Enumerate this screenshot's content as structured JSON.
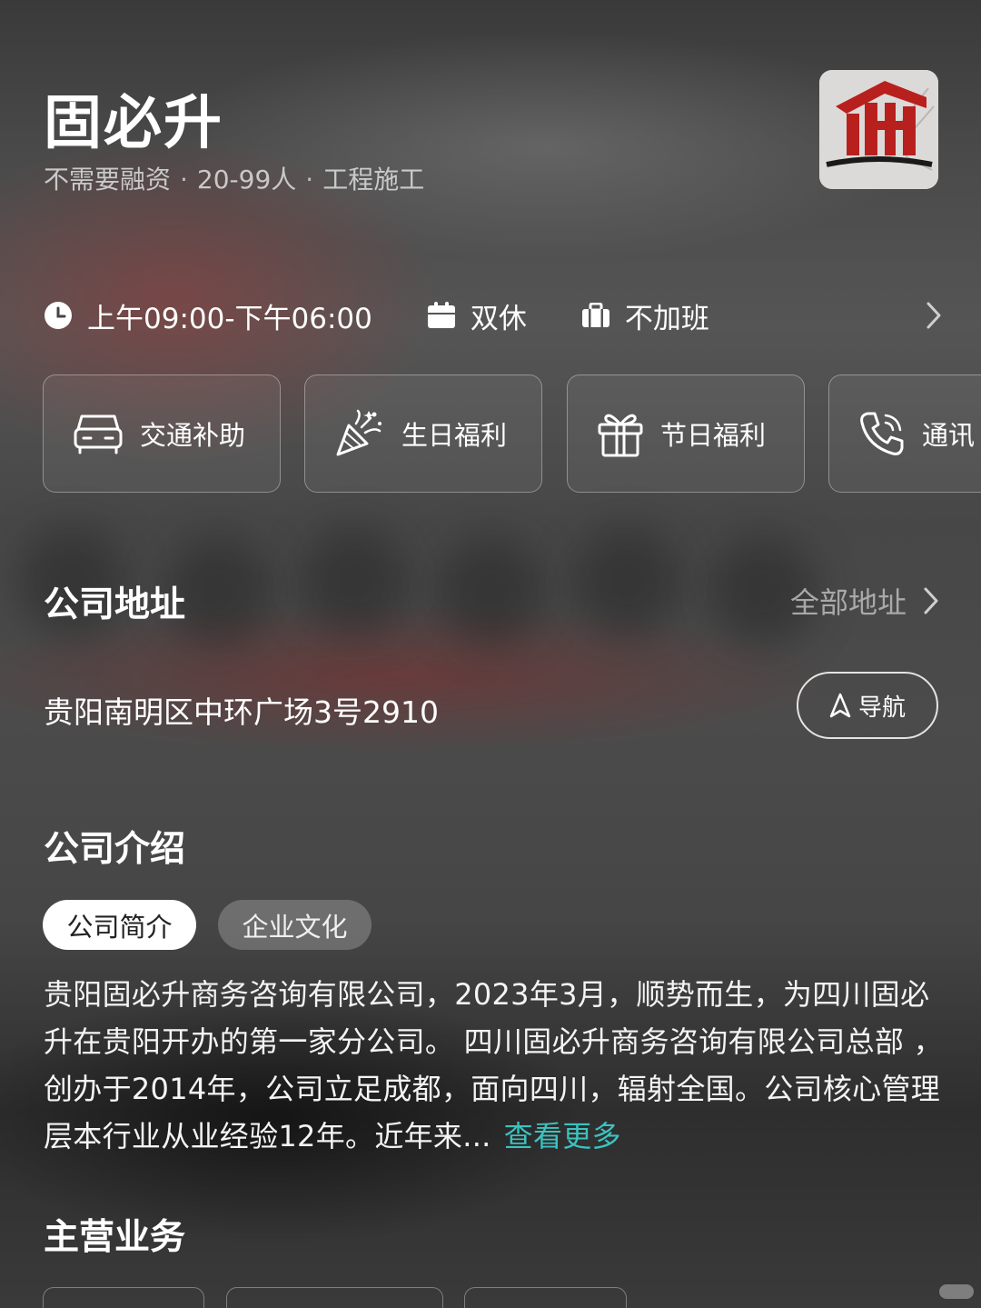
{
  "company": {
    "name": "固必升",
    "tags": [
      "不需要融资",
      "20-99人",
      "工程施工"
    ],
    "separator": "·"
  },
  "worktime": {
    "hours": "上午09:00-下午06:00",
    "rest": "双休",
    "overtime": "不加班"
  },
  "benefits": [
    {
      "label": "交通补助",
      "icon": "car-icon"
    },
    {
      "label": "生日福利",
      "icon": "party-popper-icon"
    },
    {
      "label": "节日福利",
      "icon": "gift-icon"
    },
    {
      "label": "通讯",
      "icon": "phone-icon"
    }
  ],
  "address_section": {
    "title": "公司地址",
    "all_link": "全部地址",
    "address": "贵阳南明区中环广场3号2910",
    "nav_label": "导航"
  },
  "intro_section": {
    "title": "公司介绍",
    "tabs": [
      {
        "label": "公司简介",
        "active": true
      },
      {
        "label": "企业文化",
        "active": false
      }
    ],
    "text": "贵阳固必升商务咨询有限公司，2023年3月，顺势而生，为四川固必升在贵阳开办的第一家分公司。 四川固必升商务咨询有限公司总部 ，创办于2014年，公司立足成都，面向四川，辐射全国。公司核心管理层本行业从业经验12年。近年来...",
    "see_more": "查看更多"
  },
  "business_section": {
    "title": "主营业务"
  },
  "colors": {
    "accent": "#3bc3c0",
    "logo_red": "#b8201e"
  }
}
